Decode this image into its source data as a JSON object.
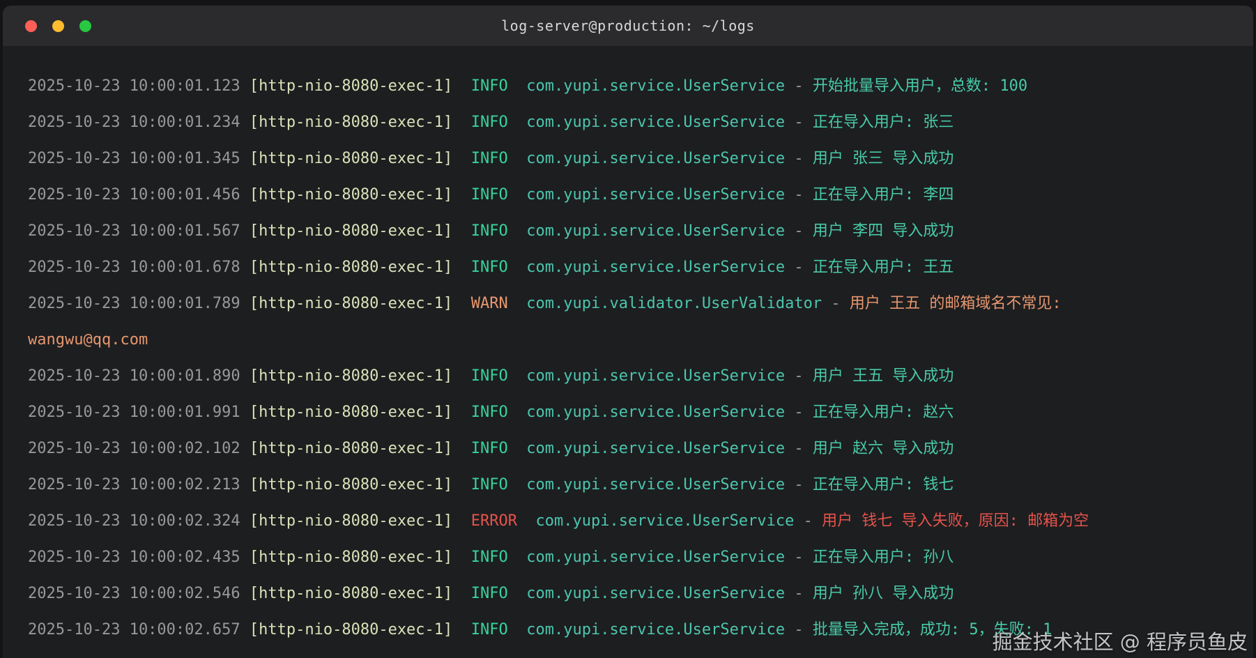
{
  "window": {
    "title": "log-server@production: ~/logs",
    "traffic_lights": [
      "close",
      "minimize",
      "zoom"
    ]
  },
  "colors": {
    "titlebar_bg": "#2b2b2d",
    "terminal_bg": "#1d1e20",
    "timestamp": "#999999",
    "thread": "#d8e2b8",
    "level_info": "#36d39b",
    "level_warn": "#e7976e",
    "level_error": "#e5534b",
    "logger": "#4cc6ae",
    "message_teal": "#48cba8",
    "traffic_red": "#ff5f57",
    "traffic_yellow": "#febc2e",
    "traffic_green": "#28c840"
  },
  "watermark": "掘金技术社区 @ 程序员鱼皮",
  "terminal": {
    "rows": [
      [
        {
          "c": "ts",
          "t": "2025-10-23 10:00:01.123 "
        },
        {
          "c": "thread",
          "t": "[http-nio-8080-exec-1]  "
        },
        {
          "c": "info",
          "t": "INFO"
        },
        {
          "c": "logger",
          "t": "  com.yupi.service.UserService"
        },
        {
          "c": "dim",
          "t": " - "
        },
        {
          "c": "teal",
          "t": "开始批量导入用户，总数: 100"
        }
      ],
      [
        {
          "c": "ts",
          "t": "2025-10-23 10:00:01.234 "
        },
        {
          "c": "thread",
          "t": "[http-nio-8080-exec-1]  "
        },
        {
          "c": "info",
          "t": "INFO"
        },
        {
          "c": "logger",
          "t": "  com.yupi.service.UserService"
        },
        {
          "c": "dim",
          "t": " - "
        },
        {
          "c": "teal",
          "t": "正在导入用户: 张三"
        }
      ],
      [
        {
          "c": "ts",
          "t": "2025-10-23 10:00:01.345 "
        },
        {
          "c": "thread",
          "t": "[http-nio-8080-exec-1]  "
        },
        {
          "c": "info",
          "t": "INFO"
        },
        {
          "c": "logger",
          "t": "  com.yupi.service.UserService"
        },
        {
          "c": "dim",
          "t": " - "
        },
        {
          "c": "teal",
          "t": "用户 张三 导入成功"
        }
      ],
      [
        {
          "c": "ts",
          "t": "2025-10-23 10:00:01.456 "
        },
        {
          "c": "thread",
          "t": "[http-nio-8080-exec-1]  "
        },
        {
          "c": "info",
          "t": "INFO"
        },
        {
          "c": "logger",
          "t": "  com.yupi.service.UserService"
        },
        {
          "c": "dim",
          "t": " - "
        },
        {
          "c": "teal",
          "t": "正在导入用户: 李四"
        }
      ],
      [
        {
          "c": "ts",
          "t": "2025-10-23 10:00:01.567 "
        },
        {
          "c": "thread",
          "t": "[http-nio-8080-exec-1]  "
        },
        {
          "c": "info",
          "t": "INFO"
        },
        {
          "c": "logger",
          "t": "  com.yupi.service.UserService"
        },
        {
          "c": "dim",
          "t": " - "
        },
        {
          "c": "teal",
          "t": "用户 李四 导入成功"
        }
      ],
      [
        {
          "c": "ts",
          "t": "2025-10-23 10:00:01.678 "
        },
        {
          "c": "thread",
          "t": "[http-nio-8080-exec-1]  "
        },
        {
          "c": "info",
          "t": "INFO"
        },
        {
          "c": "logger",
          "t": "  com.yupi.service.UserService"
        },
        {
          "c": "dim",
          "t": " - "
        },
        {
          "c": "teal",
          "t": "正在导入用户: 王五"
        }
      ],
      [
        {
          "c": "ts",
          "t": "2025-10-23 10:00:01.789 "
        },
        {
          "c": "thread",
          "t": "[http-nio-8080-exec-1]  "
        },
        {
          "c": "warn",
          "t": "WARN"
        },
        {
          "c": "logger",
          "t": "  com.yupi.validator.UserValidator"
        },
        {
          "c": "dim",
          "t": " - "
        },
        {
          "c": "warn",
          "t": "用户 王五 的邮箱域名不常见:"
        }
      ],
      [
        {
          "c": "warn",
          "t": "wangwu@qq.com"
        }
      ],
      [
        {
          "c": "ts",
          "t": "2025-10-23 10:00:01.890 "
        },
        {
          "c": "thread",
          "t": "[http-nio-8080-exec-1]  "
        },
        {
          "c": "info",
          "t": "INFO"
        },
        {
          "c": "logger",
          "t": "  com.yupi.service.UserService"
        },
        {
          "c": "dim",
          "t": " - "
        },
        {
          "c": "teal",
          "t": "用户 王五 导入成功"
        }
      ],
      [
        {
          "c": "ts",
          "t": "2025-10-23 10:00:01.991 "
        },
        {
          "c": "thread",
          "t": "[http-nio-8080-exec-1]  "
        },
        {
          "c": "info",
          "t": "INFO"
        },
        {
          "c": "logger",
          "t": "  com.yupi.service.UserService"
        },
        {
          "c": "dim",
          "t": " - "
        },
        {
          "c": "teal",
          "t": "正在导入用户: 赵六"
        }
      ],
      [
        {
          "c": "ts",
          "t": "2025-10-23 10:00:02.102 "
        },
        {
          "c": "thread",
          "t": "[http-nio-8080-exec-1]  "
        },
        {
          "c": "info",
          "t": "INFO"
        },
        {
          "c": "logger",
          "t": "  com.yupi.service.UserService"
        },
        {
          "c": "dim",
          "t": " - "
        },
        {
          "c": "teal",
          "t": "用户 赵六 导入成功"
        }
      ],
      [
        {
          "c": "ts",
          "t": "2025-10-23 10:00:02.213 "
        },
        {
          "c": "thread",
          "t": "[http-nio-8080-exec-1]  "
        },
        {
          "c": "info",
          "t": "INFO"
        },
        {
          "c": "logger",
          "t": "  com.yupi.service.UserService"
        },
        {
          "c": "dim",
          "t": " - "
        },
        {
          "c": "teal",
          "t": "正在导入用户: 钱七"
        }
      ],
      [
        {
          "c": "ts",
          "t": "2025-10-23 10:00:02.324 "
        },
        {
          "c": "thread",
          "t": "[http-nio-8080-exec-1]  "
        },
        {
          "c": "error",
          "t": "ERROR"
        },
        {
          "c": "logger",
          "t": "  com.yupi.service.UserService"
        },
        {
          "c": "dim",
          "t": " - "
        },
        {
          "c": "error",
          "t": "用户 钱七 导入失败，原因: 邮箱为空"
        }
      ],
      [
        {
          "c": "ts",
          "t": "2025-10-23 10:00:02.435 "
        },
        {
          "c": "thread",
          "t": "[http-nio-8080-exec-1]  "
        },
        {
          "c": "info",
          "t": "INFO"
        },
        {
          "c": "logger",
          "t": "  com.yupi.service.UserService"
        },
        {
          "c": "dim",
          "t": " - "
        },
        {
          "c": "teal",
          "t": "正在导入用户: 孙八"
        }
      ],
      [
        {
          "c": "ts",
          "t": "2025-10-23 10:00:02.546 "
        },
        {
          "c": "thread",
          "t": "[http-nio-8080-exec-1]  "
        },
        {
          "c": "info",
          "t": "INFO"
        },
        {
          "c": "logger",
          "t": "  com.yupi.service.UserService"
        },
        {
          "c": "dim",
          "t": " - "
        },
        {
          "c": "teal",
          "t": "用户 孙八 导入成功"
        }
      ],
      [
        {
          "c": "ts",
          "t": "2025-10-23 10:00:02.657 "
        },
        {
          "c": "thread",
          "t": "[http-nio-8080-exec-1]  "
        },
        {
          "c": "info",
          "t": "INFO"
        },
        {
          "c": "logger",
          "t": "  com.yupi.service.UserService"
        },
        {
          "c": "dim",
          "t": " - "
        },
        {
          "c": "teal",
          "t": "批量导入完成，成功: 5，失败: 1"
        }
      ]
    ]
  }
}
